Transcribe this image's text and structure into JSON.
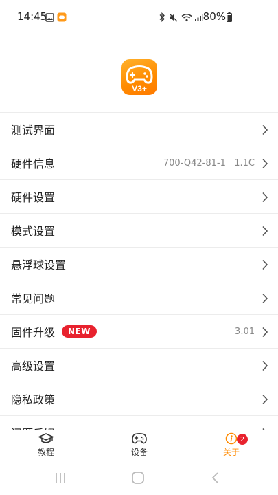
{
  "status_bar": {
    "time": "14:45",
    "battery": "80%",
    "icons": [
      "gallery-icon",
      "app-notification-icon",
      "bluetooth-icon",
      "mute-icon",
      "wifi-icon",
      "signal-icon",
      "battery-icon"
    ]
  },
  "logo": {
    "text": "V3+",
    "brand_color": "#ff8a00"
  },
  "menu": {
    "items": [
      {
        "label": "测试界面",
        "value": ""
      },
      {
        "label": "硬件信息",
        "value": "700-Q42-81-1   1.1C"
      },
      {
        "label": "硬件设置",
        "value": ""
      },
      {
        "label": "模式设置",
        "value": ""
      },
      {
        "label": "悬浮球设置",
        "value": ""
      },
      {
        "label": "常见问题",
        "value": ""
      },
      {
        "label": "固件升级",
        "value": "3.01",
        "badge": "NEW"
      },
      {
        "label": "高级设置",
        "value": ""
      },
      {
        "label": "隐私政策",
        "value": ""
      },
      {
        "label": "问题反馈",
        "value": ""
      }
    ]
  },
  "tabs": [
    {
      "label": "教程",
      "icon": "graduation-cap-icon"
    },
    {
      "label": "设备",
      "icon": "gamepad-icon"
    },
    {
      "label": "关于",
      "icon": "info-icon",
      "badge": "2",
      "active": true
    }
  ],
  "colors": {
    "accent": "#ff8a00",
    "badge_red": "#e8222e"
  }
}
